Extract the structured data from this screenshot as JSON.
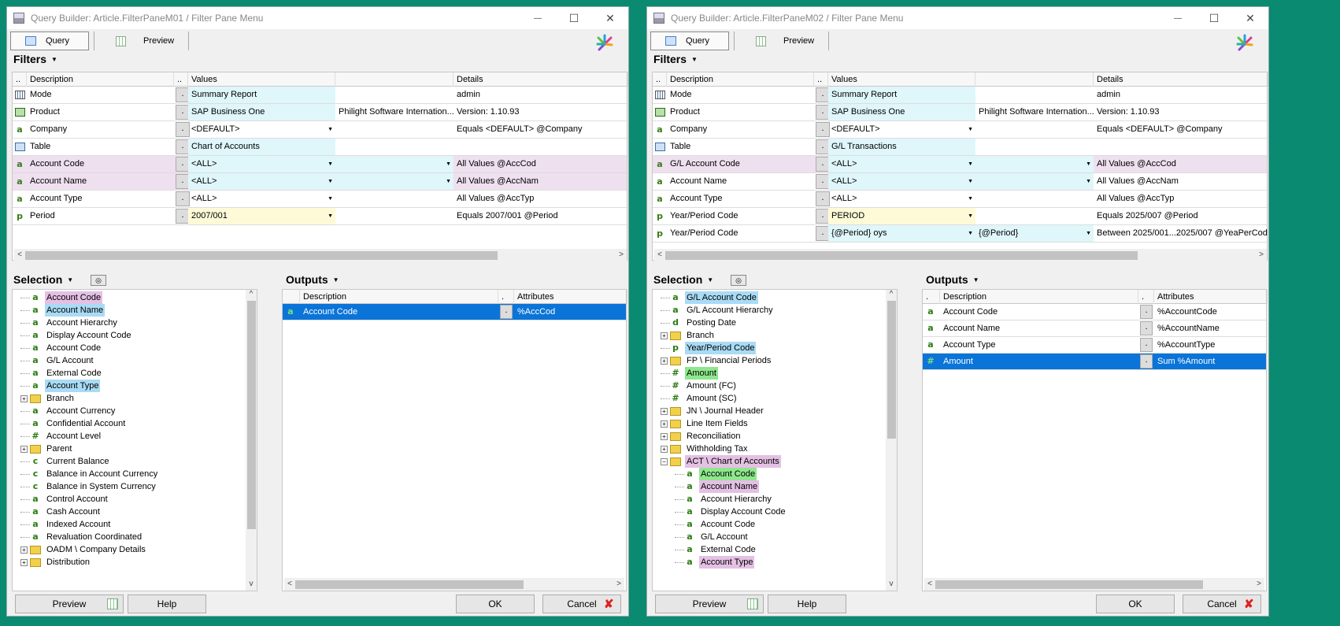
{
  "windows": [
    {
      "title": "Query Builder:  Article.FilterPaneM01 / Filter Pane Menu",
      "tabs": [
        "Query",
        "Preview"
      ],
      "filters_title": "Filters",
      "filter_headers": [
        "..",
        "Description",
        "..",
        "Values",
        "",
        "Details"
      ],
      "filters": [
        {
          "icon": "mode-icon",
          "desc": "Mode",
          "value": "Summary Report",
          "value2": "",
          "details": "admin",
          "style": "plain",
          "vstyle": "cyan",
          "dd1": false,
          "dd2": false
        },
        {
          "icon": "product-icon",
          "desc": "Product",
          "value": "SAP Business One",
          "value2": "Philight Software Internation...",
          "details": "Version: 1.10.93",
          "style": "plain",
          "vstyle": "cyan",
          "dd1": false,
          "dd2": false
        },
        {
          "icon": "a",
          "desc": "Company",
          "value": "<DEFAULT>",
          "value2": "",
          "details": "Equals <DEFAULT> @Company",
          "style": "plain",
          "vstyle": "none",
          "dd1": true,
          "dd2": false
        },
        {
          "icon": "table-icon",
          "desc": "Table",
          "value": "Chart of Accounts",
          "value2": "",
          "details": "",
          "style": "plain",
          "vstyle": "cyan",
          "dd1": false,
          "dd2": false
        },
        {
          "icon": "a",
          "desc": "Account Code",
          "value": "<ALL>",
          "value2": "",
          "details": "All Values @AccCod",
          "style": "pink",
          "vstyle": "cyan",
          "dd1": true,
          "dd2": true
        },
        {
          "icon": "a",
          "desc": "Account Name",
          "value": "<ALL>",
          "value2": "",
          "details": "All Values @AccNam",
          "style": "pink",
          "vstyle": "cyan",
          "dd1": true,
          "dd2": true
        },
        {
          "icon": "a",
          "desc": "Account Type",
          "value": "<ALL>",
          "value2": "",
          "details": "All Values @AccTyp",
          "style": "plain",
          "vstyle": "none",
          "dd1": true,
          "dd2": false
        },
        {
          "icon": "p",
          "desc": "Period",
          "value": "2007/001",
          "value2": "",
          "details": "Equals 2007/001 @Period",
          "style": "plain",
          "vstyle": "yellow",
          "dd1": true,
          "dd2": false
        }
      ],
      "selection_title": "Selection",
      "selection": [
        {
          "icon": "a",
          "label": "Account Code",
          "hl": "pink",
          "indent": 0,
          "folder": false
        },
        {
          "icon": "a",
          "label": "Account Name",
          "hl": "blue",
          "indent": 0,
          "folder": false
        },
        {
          "icon": "a",
          "label": "Account Hierarchy",
          "hl": "",
          "indent": 0,
          "folder": false
        },
        {
          "icon": "a",
          "label": "Display Account Code",
          "hl": "",
          "indent": 0,
          "folder": false
        },
        {
          "icon": "a",
          "label": "Account Code",
          "hl": "",
          "indent": 0,
          "folder": false
        },
        {
          "icon": "a",
          "label": "G/L Account",
          "hl": "",
          "indent": 0,
          "folder": false
        },
        {
          "icon": "a",
          "label": "External Code",
          "hl": "",
          "indent": 0,
          "folder": false
        },
        {
          "icon": "a",
          "label": "Account Type",
          "hl": "blue",
          "indent": 0,
          "folder": false
        },
        {
          "icon": "",
          "label": "Branch",
          "hl": "",
          "indent": 0,
          "folder": true
        },
        {
          "icon": "a",
          "label": "Account Currency",
          "hl": "",
          "indent": 0,
          "folder": false
        },
        {
          "icon": "a",
          "label": "Confidential Account",
          "hl": "",
          "indent": 0,
          "folder": false
        },
        {
          "icon": "#",
          "label": "Account Level",
          "hl": "",
          "indent": 0,
          "folder": false
        },
        {
          "icon": "",
          "label": "Parent",
          "hl": "",
          "indent": 0,
          "folder": true
        },
        {
          "icon": "c",
          "label": "Current Balance",
          "hl": "",
          "indent": 0,
          "folder": false
        },
        {
          "icon": "c",
          "label": "Balance in Account Currency",
          "hl": "",
          "indent": 0,
          "folder": false
        },
        {
          "icon": "c",
          "label": "Balance in System Currency",
          "hl": "",
          "indent": 0,
          "folder": false
        },
        {
          "icon": "a",
          "label": "Control Account",
          "hl": "",
          "indent": 0,
          "folder": false
        },
        {
          "icon": "a",
          "label": "Cash Account",
          "hl": "",
          "indent": 0,
          "folder": false
        },
        {
          "icon": "a",
          "label": "Indexed Account",
          "hl": "",
          "indent": 0,
          "folder": false
        },
        {
          "icon": "a",
          "label": "Revaluation Coordinated",
          "hl": "",
          "indent": 0,
          "folder": false
        },
        {
          "icon": "",
          "label": "OADM \\ Company Details",
          "hl": "",
          "indent": 0,
          "folder": true
        },
        {
          "icon": "",
          "label": "Distribution",
          "hl": "",
          "indent": 0,
          "folder": true
        }
      ],
      "outputs_title": "Outputs",
      "output_headers": [
        "",
        "Description",
        ".",
        "Attributes"
      ],
      "outputs": [
        {
          "icon": "a",
          "desc": "Account Code",
          "attr": "%AccCod",
          "selected": true
        }
      ],
      "buttons": {
        "preview": "Preview",
        "help": "Help",
        "ok": "OK",
        "cancel": "Cancel"
      }
    },
    {
      "title": "Query Builder:  Article.FilterPaneM02 / Filter Pane Menu",
      "tabs": [
        "Query",
        "Preview"
      ],
      "filters_title": "Filters",
      "filter_headers": [
        "..",
        "Description",
        "..",
        "Values",
        "",
        "Details"
      ],
      "filters": [
        {
          "icon": "mode-icon",
          "desc": "Mode",
          "value": "Summary Report",
          "value2": "",
          "details": "admin",
          "style": "plain",
          "vstyle": "cyan",
          "dd1": false,
          "dd2": false
        },
        {
          "icon": "product-icon",
          "desc": "Product",
          "value": "SAP Business One",
          "value2": "Philight Software Internation...",
          "details": "Version: 1.10.93",
          "style": "plain",
          "vstyle": "cyan",
          "dd1": false,
          "dd2": false
        },
        {
          "icon": "a",
          "desc": "Company",
          "value": "<DEFAULT>",
          "value2": "",
          "details": "Equals <DEFAULT> @Company",
          "style": "plain",
          "vstyle": "none",
          "dd1": true,
          "dd2": false
        },
        {
          "icon": "table-icon",
          "desc": "Table",
          "value": "G/L Transactions",
          "value2": "",
          "details": "",
          "style": "plain",
          "vstyle": "cyan",
          "dd1": false,
          "dd2": false
        },
        {
          "icon": "a",
          "desc": "G/L Account Code",
          "value": "<ALL>",
          "value2": "",
          "details": "All Values @AccCod",
          "style": "pink",
          "vstyle": "cyan",
          "dd1": true,
          "dd2": true
        },
        {
          "icon": "a",
          "desc": "Account Name",
          "value": "<ALL>",
          "value2": "",
          "details": "All Values @AccNam",
          "style": "plain",
          "vstyle": "cyan",
          "dd1": true,
          "dd2": true
        },
        {
          "icon": "a",
          "desc": "Account Type",
          "value": "<ALL>",
          "value2": "",
          "details": "All Values @AccTyp",
          "style": "plain",
          "vstyle": "none",
          "dd1": true,
          "dd2": false
        },
        {
          "icon": "p",
          "desc": "Year/Period Code",
          "value": "PERIOD",
          "value2": "",
          "details": "Equals 2025/007 @Period",
          "style": "plain",
          "vstyle": "yellow",
          "dd1": true,
          "dd2": false
        },
        {
          "icon": "p",
          "desc": "Year/Period Code",
          "value": "{@Period} oys",
          "value2": "{@Period}",
          "details": "Between 2025/001...2025/007 @YeaPerCod",
          "style": "plain",
          "vstyle": "cyan",
          "dd1": true,
          "dd2": true
        }
      ],
      "selection_title": "Selection",
      "selection": [
        {
          "icon": "a",
          "label": "G/L Account Code",
          "hl": "blue",
          "indent": 0,
          "folder": false
        },
        {
          "icon": "a",
          "label": "G/L Account Hierarchy",
          "hl": "",
          "indent": 0,
          "folder": false
        },
        {
          "icon": "d",
          "label": "Posting Date",
          "hl": "",
          "indent": 0,
          "folder": false
        },
        {
          "icon": "",
          "label": "Branch",
          "hl": "",
          "indent": 0,
          "folder": true
        },
        {
          "icon": "p",
          "label": "Year/Period Code",
          "hl": "blue",
          "indent": 0,
          "folder": false
        },
        {
          "icon": "",
          "label": "FP \\ Financial Periods",
          "hl": "",
          "indent": 0,
          "folder": true
        },
        {
          "icon": "#",
          "label": "Amount",
          "hl": "green",
          "indent": 0,
          "folder": false
        },
        {
          "icon": "#",
          "label": "Amount (FC)",
          "hl": "",
          "indent": 0,
          "folder": false
        },
        {
          "icon": "#",
          "label": "Amount (SC)",
          "hl": "",
          "indent": 0,
          "folder": false
        },
        {
          "icon": "",
          "label": "JN \\ Journal Header",
          "hl": "",
          "indent": 0,
          "folder": true
        },
        {
          "icon": "",
          "label": "Line Item Fields",
          "hl": "",
          "indent": 0,
          "folder": true
        },
        {
          "icon": "",
          "label": "Reconciliation",
          "hl": "",
          "indent": 0,
          "folder": true
        },
        {
          "icon": "",
          "label": "Withholding Tax",
          "hl": "",
          "indent": 0,
          "folder": true
        },
        {
          "icon": "",
          "label": "ACT \\ Chart of Accounts",
          "hl": "pink",
          "indent": 0,
          "folder": true,
          "open": true
        },
        {
          "icon": "a",
          "label": "Account Code",
          "hl": "green",
          "indent": 1,
          "folder": false
        },
        {
          "icon": "a",
          "label": "Account Name",
          "hl": "pink",
          "indent": 1,
          "folder": false
        },
        {
          "icon": "a",
          "label": "Account Hierarchy",
          "hl": "",
          "indent": 1,
          "folder": false
        },
        {
          "icon": "a",
          "label": "Display Account Code",
          "hl": "",
          "indent": 1,
          "folder": false
        },
        {
          "icon": "a",
          "label": "Account Code",
          "hl": "",
          "indent": 1,
          "folder": false
        },
        {
          "icon": "a",
          "label": "G/L Account",
          "hl": "",
          "indent": 1,
          "folder": false
        },
        {
          "icon": "a",
          "label": "External Code",
          "hl": "",
          "indent": 1,
          "folder": false
        },
        {
          "icon": "a",
          "label": "Account Type",
          "hl": "pink",
          "indent": 1,
          "folder": false
        }
      ],
      "outputs_title": "Outputs",
      "output_headers": [
        ".",
        "Description",
        ".",
        "Attributes"
      ],
      "outputs": [
        {
          "icon": "a",
          "desc": "Account Code",
          "attr": "%AccountCode",
          "selected": false
        },
        {
          "icon": "a",
          "desc": "Account Name",
          "attr": "%AccountName",
          "selected": false
        },
        {
          "icon": "a",
          "desc": "Account Type",
          "attr": "%AccountType",
          "selected": false
        },
        {
          "icon": "#",
          "desc": "Amount",
          "attr": "Sum %Amount",
          "selected": true
        }
      ],
      "buttons": {
        "preview": "Preview",
        "help": "Help",
        "ok": "OK",
        "cancel": "Cancel"
      }
    }
  ],
  "colors": {
    "desktop": "#0b8a72",
    "selection": "#0b74d8",
    "highlight_blue": "#a9dbf5",
    "highlight_pink": "#e4c0e4",
    "highlight_green": "#8ee78c",
    "value_cyan": "#dff6fb",
    "value_yellow": "#fefad8"
  }
}
